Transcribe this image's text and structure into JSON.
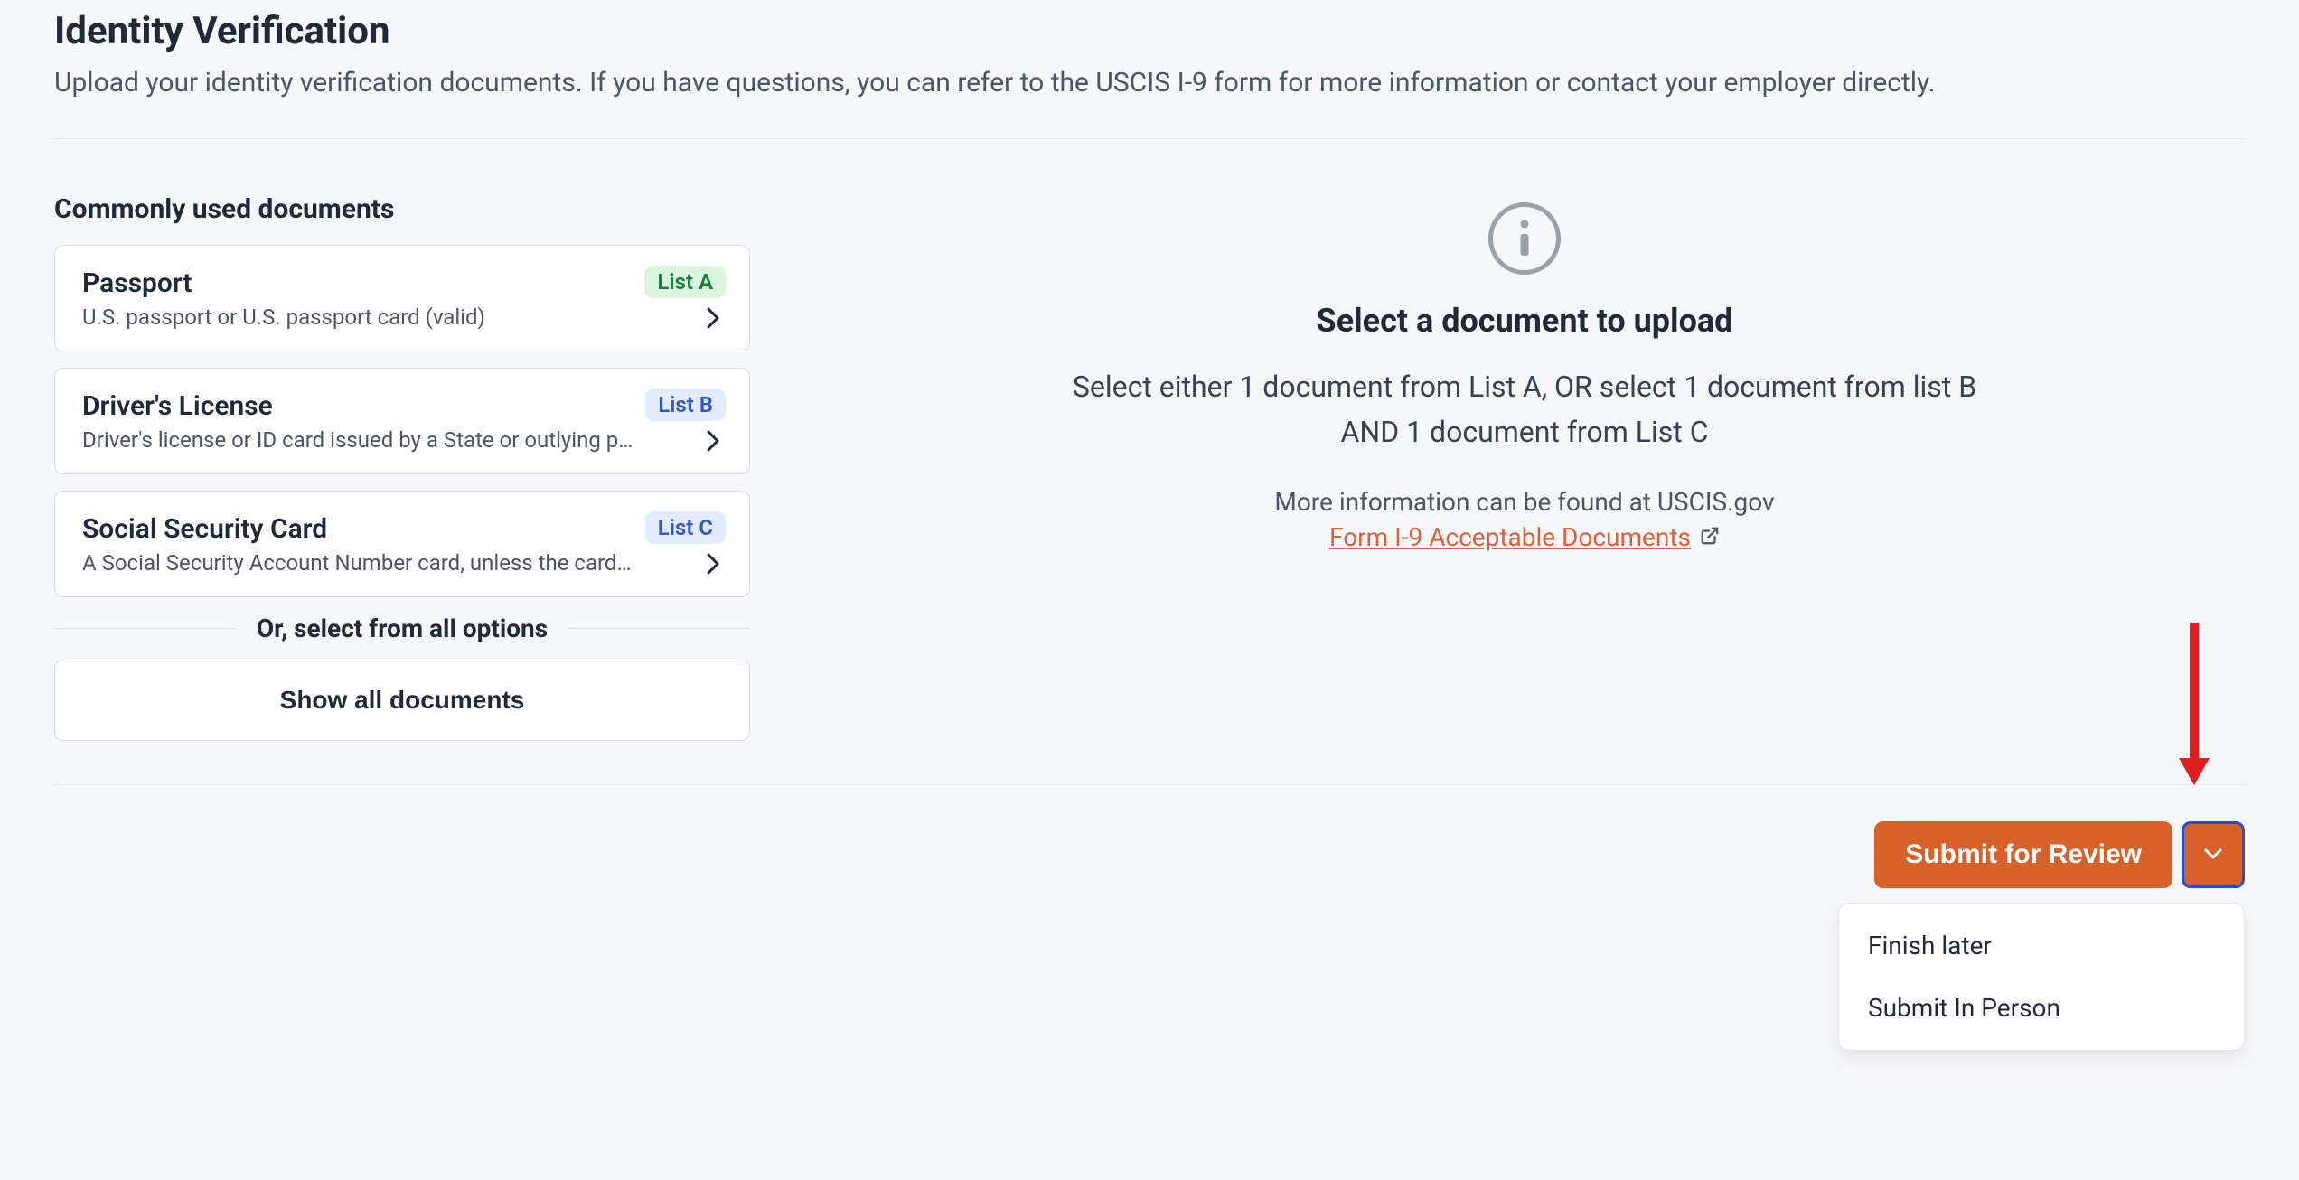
{
  "header": {
    "title": "Identity Verification",
    "subtitle": "Upload your identity verification documents. If you have questions, you can refer to the USCIS I-9 form for more information or contact your employer directly."
  },
  "left": {
    "section_heading": "Commonly used documents",
    "documents": [
      {
        "title": "Passport",
        "desc": "U.S. passport or U.S. passport card (valid)",
        "badge": "List A",
        "badge_class": "list-a"
      },
      {
        "title": "Driver's License",
        "desc": "Driver's license or ID card issued by a State or outlying p…",
        "badge": "List B",
        "badge_class": "list-b"
      },
      {
        "title": "Social Security Card",
        "desc": "A Social Security Account Number card, unless the card …",
        "badge": "List C",
        "badge_class": "list-c"
      }
    ],
    "divider_text": "Or, select from all options",
    "show_all_label": "Show all documents"
  },
  "right": {
    "heading": "Select a document to upload",
    "paragraph": "Select either 1 document from List A, OR select 1 document from list B AND 1 document from List C",
    "more_info": "More information can be found at USCIS.gov",
    "link_text": "Form I-9 Acceptable Documents "
  },
  "footer": {
    "submit_label": "Submit for Review",
    "menu": {
      "finish_later": "Finish later",
      "submit_in_person": "Submit In Person"
    }
  }
}
